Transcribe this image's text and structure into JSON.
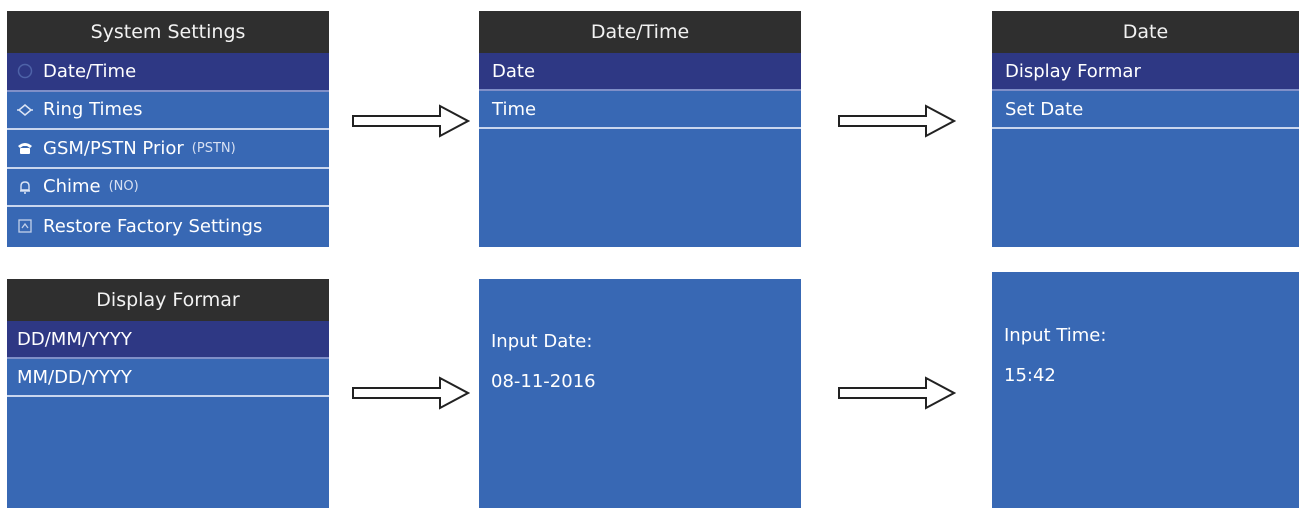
{
  "screen1": {
    "title": "System Settings",
    "items": [
      {
        "label": "Date/Time",
        "icon": "clock-icon",
        "suffix": ""
      },
      {
        "label": "Ring Times",
        "icon": "bell-ring-icon",
        "suffix": ""
      },
      {
        "label": "GSM/PSTN Prior",
        "icon": "phone-icon",
        "suffix": "(PSTN)"
      },
      {
        "label": "Chime",
        "icon": "chime-icon",
        "suffix": "(NO)"
      },
      {
        "label": "Restore Factory Settings",
        "icon": "restore-icon",
        "suffix": ""
      }
    ]
  },
  "screen2": {
    "title": "Date/Time",
    "items": [
      {
        "label": "Date"
      },
      {
        "label": "Time"
      }
    ]
  },
  "screen3": {
    "title": "Date",
    "items": [
      {
        "label": "Display Formar"
      },
      {
        "label": "Set Date"
      }
    ]
  },
  "screen4": {
    "title": "Display Formar",
    "items": [
      {
        "label": "DD/MM/YYYY"
      },
      {
        "label": "MM/DD/YYYY"
      }
    ]
  },
  "screen5": {
    "prompt": "Input Date:",
    "value": "08-11-2016"
  },
  "screen6": {
    "prompt": "Input Time:",
    "value": "15:42"
  },
  "colors": {
    "screen_bg": "#3868b4",
    "titlebar_bg": "#2f2f2f",
    "selected_bg": "#2e3884",
    "divider": "#c9d6ee"
  }
}
